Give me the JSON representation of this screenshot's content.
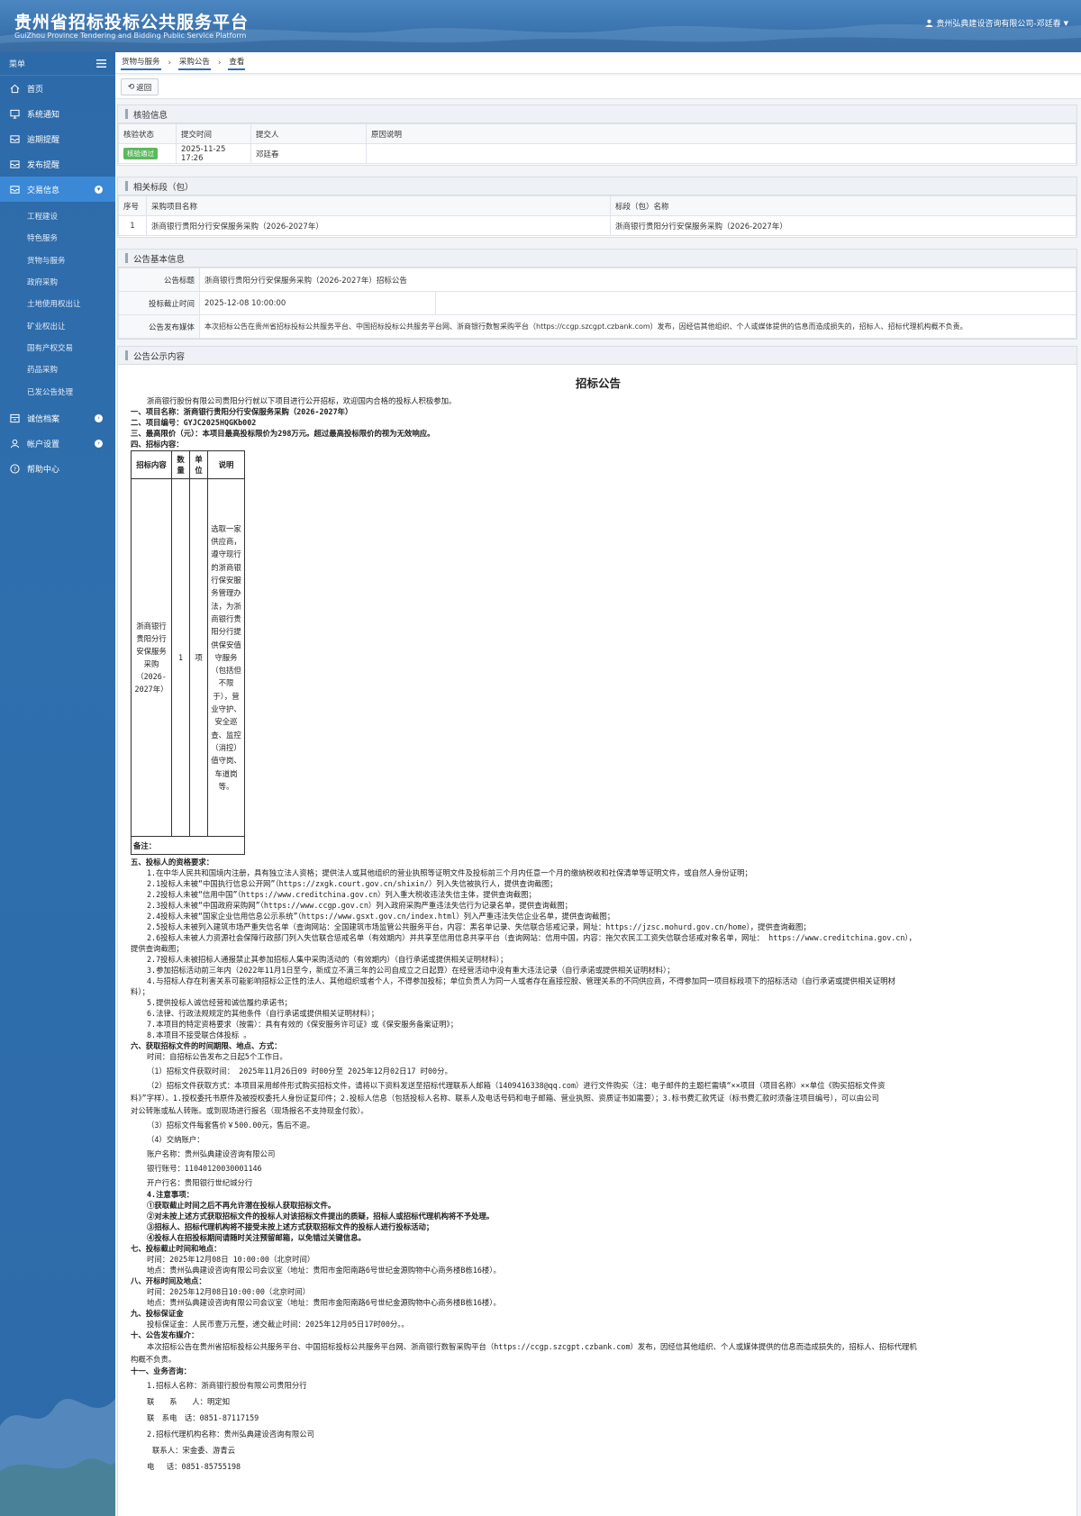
{
  "header": {
    "title": "贵州省招标投标公共服务平台",
    "subtitle": "GuiZhou Province Tendering and Bidding Public Service Platform",
    "user": "贵州弘典建设咨询有限公司-邓廷春"
  },
  "sidebar": {
    "menu_label": "菜单",
    "items": [
      {
        "label": "首页",
        "icon": "home-icon"
      },
      {
        "label": "系统通知",
        "icon": "monitor-icon"
      },
      {
        "label": "逾期提醒",
        "icon": "inbox-icon"
      },
      {
        "label": "发布提醒",
        "icon": "inbox-icon"
      },
      {
        "label": "交易信息",
        "icon": "inbox-icon",
        "active": true
      },
      {
        "label": "诚信档案",
        "icon": "archive-icon"
      },
      {
        "label": "帐户设置",
        "icon": "user-icon"
      },
      {
        "label": "帮助中心",
        "icon": "help-icon"
      }
    ],
    "sub_items": [
      "工程建设",
      "特色服务",
      "货物与服务",
      "政府采购",
      "土地使用权出让",
      "矿业权出让",
      "国有产权交易",
      "药品采购",
      "已发公告处理"
    ]
  },
  "breadcrumb": [
    "货物与服务",
    "采购公告",
    "查看"
  ],
  "back_label": "返回",
  "verify": {
    "heading": "核验信息",
    "columns": [
      "核验状态",
      "提交时间",
      "提交人",
      "原因说明"
    ],
    "row": {
      "status": "核验通过",
      "time": "2025-11-25 17:26",
      "person": "邓廷春",
      "reason": ""
    }
  },
  "sections": {
    "heading": "相关标段（包）",
    "columns": [
      "序号",
      "采购项目名称",
      "标段（包）名称"
    ],
    "row": {
      "no": "1",
      "project": "浙商银行贵阳分行安保服务采购（2026-2027年）",
      "section": "浙商银行贵阳分行安保服务采购（2026-2027年）"
    }
  },
  "basic": {
    "heading": "公告基本信息",
    "title_label": "公告标题",
    "title_value": "浙商银行贵阳分行安保服务采购（2026-2027年）招标公告",
    "deadline_label": "投标截止时间",
    "deadline_value": "2025-12-08 10:00:00",
    "media_label": "公告发布媒体",
    "media_value": "本次招标公告在贵州省招标投标公共服务平台、中国招标投标公共服务平台网、浙商银行数智采购平台（https://ccgp.szcgpt.czbank.com）发布，因经信其他组织、个人或媒体提供的信息而造成损失的，招标人、招标代理机构概不负责。"
  },
  "content": {
    "heading": "公告公示内容",
    "doc_title": "招标公告",
    "intro": "浙商银行股份有限公司贵阳分行就以下项目进行公开招标，欢迎国内合格的投标人积极参加。",
    "l1": "一、项目名称：浙商银行贵阳分行安保服务采购（2026-2027年）",
    "l2": "二、项目编号：GYJC2025HQGKb002",
    "l3": "三、最高限价（元）：本项目最高投标限价为298万元。超过最高投标限价的视为无效响应。",
    "l4": "四、招标内容：",
    "table_head": [
      "招标内容",
      "数量",
      "单位",
      "说明"
    ],
    "table_row": [
      "浙商银行贵阳分行安保服务采购（2026-2027年）",
      "1",
      "项",
      "选取一家供应商，遵守现行的浙商银行保安服务管理办法，为浙商银行贵阳分行提供保安值守服务（包括但不限于），营业守护、安全巡查、监控（消控）值守岗、车道岗等。"
    ],
    "table_note": "备注：",
    "s5": "五、投标人的资格要求：",
    "q1": "1.在中华人民共和国境内注册，具有独立法人资格；提供法人或其他组织的营业执照等证明文件及投标前三个月内任意一个月的缴纳税收和社保清单等证明文件，或自然人身份证明；",
    "q2": "2.1投标人未被“中国执行信息公开网”（https://zxgk.court.gov.cn/shixin/）列入失信被执行人，提供查询截图；",
    "q3": "2.2投标人未被“信用中国”（https://www.creditchina.gov.cn）列入重大税收违法失信主体，提供查询截图；",
    "q4": "2.3投标人未被“中国政府采购网”（https://www.ccgp.gov.cn）列入政府采购严重违法失信行为记录名单，提供查询截图；",
    "q5": "2.4投标人未被“国家企业信用信息公示系统”（https://www.gsxt.gov.cn/index.html）列入严重违法失信企业名单，提供查询截图；",
    "q6": "2.5投标人未被列入建筑市场严重失信名单（查询网站：全国建筑市场监管公共服务平台，内容：黑名单记录、失信联合惩戒记录，网址：https://jzsc.mohurd.gov.cn/home），提供查询截图；",
    "q7a": "2.6投标人未被人力资源社会保障行政部门列入失信联合惩戒名单（有效期内）并共享至信用信息共享平台（查询网站：信用中国，内容：拖欠农民工工资失信联合惩戒对象名单，网址： https://www.creditchina.gov.cn），",
    "q7b": "提供查询截图；",
    "q8": "2.7投标人未被招标人通报禁止其参加招标人集中采购活动的（有效期内）（自行承诺或提供相关证明材料）；",
    "q9": "3.参加招标活动前三年内（2022年11月1日至今，新成立不满三年的公司自成立之日起算）在经营活动中没有重大违法记录（自行承诺或提供相关证明材料）；",
    "q10a": "4.与招标人存在利害关系可能影响招标公正性的法人、其他组织或者个人，不得参加投标；单位负责人为同一人或者存在直接控股、管理关系的不同供应商，不得参加同一项目标段项下的招标活动（自行承诺或提供相关证明材",
    "q10b": "料）；",
    "q11": "5.提供投标人诚信经营和诚信履约承诺书；",
    "q12": "6.法律、行政法规规定的其他条件（自行承诺或提供相关证明材料）；",
    "q13": "7.本项目的特定资格要求（按需）：具有有效的《保安服务许可证》或《保安服务备案证明》；",
    "q14": "8.本项目不接受联合体投标 。",
    "s6": "六、获取招标文件的时间期限、地点、方式：",
    "t1": "时间：自招标公告发布之日起5个工作日。",
    "t2": "（1）招标文件获取时间： 2025年11月26日09 时00分至 2025年12月02日17 时00分。",
    "t3a": "（2）招标文件获取方式：本项目采用邮件形式购买招标文件，请将以下资料发送至招标代理联系人邮箱（1409416338@qq.com）进行文件购买（注：电子邮件的主题栏需填“××项目（项目名称）××单位《购买招标文件资",
    "t3b": "料》”字样）。1.授权委托书原件及被授权委托人身份证复印件；2.投标人信息（包括投标人名称、联系人及电话号码和电子邮箱、营业执照、资质证书如需要）；3.标书费汇款凭证（标书费汇款时须备注项目编号），可以由公司",
    "t3c": "对公转账或私人转账。或到现场进行报名（现场报名不支持现金付款）。",
    "t4": "（3）招标文件每套售价￥500.00元，售后不退。",
    "t5": "（4）交纳账户：",
    "t6": "账户名称：贵州弘典建设咨询有限公司",
    "t7": "银行账号：11040120030001146",
    "t8": "开户行名：贵阳银行世纪城分行",
    "n0": "4.注意事项：",
    "n1": "①获取截止时间之后不再允许潜在投标人获取招标文件。",
    "n2": "②对未按上述方式获取招标文件的投标人对该招标文件提出的质疑，招标人或招标代理机构将不予处理。",
    "n3": "③招标人、招标代理机构将不接受未按上述方式获取招标文件的投标人进行投标活动；",
    "n4": "④投标人在招投标期间请随时关注预留邮箱，以免错过关键信息。",
    "s7": "七、投标截止时间和地点：",
    "s7a": "时间：2025年12月08日 10:00:00（北京时间）",
    "s7b": "地点：贵州弘典建设咨询有限公司会议室（地址：贵阳市金阳南路6号世纪金源购物中心商务楼B栋16楼）。",
    "s8": "八、开标时间及地点：",
    "s8a": "时间：2025年12月08日10:00:00（北京时间）",
    "s8b": "地点：贵州弘典建设咨询有限公司会议室（地址：贵阳市金阳南路6号世纪金源购物中心商务楼B栋16楼）。",
    "s9": "九、投标保证金",
    "s9a": "投标保证金：人民币壹万元整，递交截止时间：2025年12月05日17时00分。。",
    "s10": "十、公告发布媒介：",
    "s10a": "本次招标公告在贵州省招标投标公共服务平台、中国招标投标公共服务平台网、浙商银行数智采购平台（https://ccgp.szcgpt.czbank.com）发布，因经信其他组织、个人或媒体提供的信息而造成损失的，招标人、招标代理机",
    "s10b": "构概不负责。",
    "s11": "十一、业务咨询：",
    "c1": "1.招标人名称：浙商银行股份有限公司贵阳分行",
    "c2": "联　　系　　人：明定知",
    "c3": "联　系电　话：0851-87117159",
    "c4": "2.招标代理机构名称：贵州弘典建设咨询有限公司",
    "c5": "联系人：宋金委、游青云",
    "c6": "电　 话：0851-85755198"
  }
}
